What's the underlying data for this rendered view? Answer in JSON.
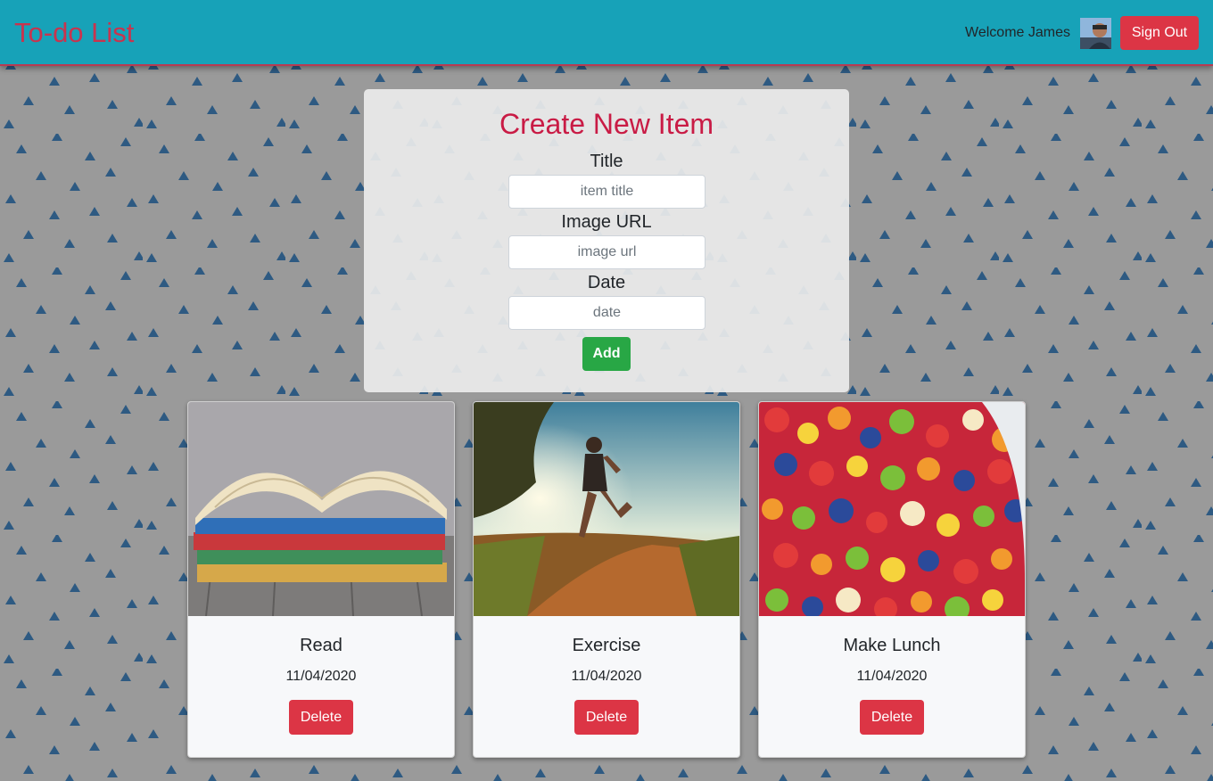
{
  "navbar": {
    "brand": "To-do List",
    "welcome": "Welcome James",
    "sign_out_label": "Sign Out"
  },
  "form": {
    "title": "Create New Item",
    "fields": [
      {
        "label": "Title",
        "placeholder": "item title"
      },
      {
        "label": "Image URL",
        "placeholder": "image url"
      },
      {
        "label": "Date",
        "placeholder": "date"
      }
    ],
    "add_label": "Add"
  },
  "items": [
    {
      "title": "Read",
      "date": "11/04/2020",
      "delete_label": "Delete",
      "image": "books"
    },
    {
      "title": "Exercise",
      "date": "11/04/2020",
      "delete_label": "Delete",
      "image": "runner"
    },
    {
      "title": "Make Lunch",
      "date": "11/04/2020",
      "delete_label": "Delete",
      "image": "fruit-salad"
    }
  ],
  "colors": {
    "navbar": "#17a2b8",
    "brand": "#c8344e",
    "form_title": "#c91b45",
    "danger": "#dc3545",
    "success": "#28a745",
    "pattern_triangle": "#2e5a82",
    "page_background": "#9a9a9a"
  }
}
